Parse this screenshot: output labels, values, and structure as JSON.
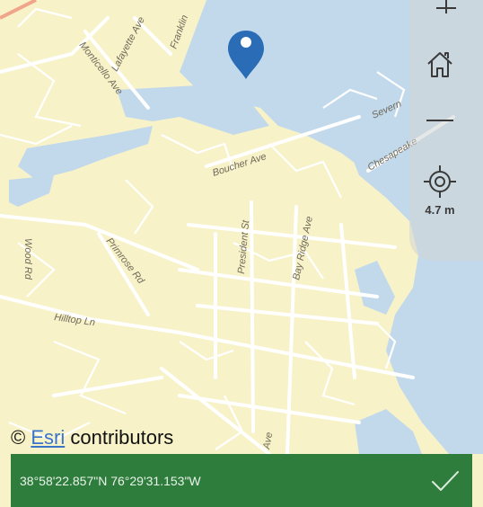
{
  "map": {
    "street_labels": {
      "monticello": "Monticello Ave",
      "lafayette": "Lafayette Ave",
      "franklin": "Franklin",
      "boucher": "Boucher Ave",
      "president": "President St",
      "bay_ridge": "Bay Ridge Ave",
      "primrose": "Primrose Rd",
      "hilltop": "Hilltop Ln",
      "chesapeake": "Chesapeake",
      "severn": "Severn",
      "wood": "Wood Rd",
      "ave_bottom": "Ave",
      "shuster": "Shuster Ave"
    },
    "colors": {
      "land": "#f8f2c8",
      "water": "#c2d9ec",
      "roads": "#ffffff",
      "pin": "#2a6cb5"
    }
  },
  "controls": {
    "zoom_in_icon": "plus-icon",
    "home_icon": "home-icon",
    "zoom_out_icon": "minus-icon",
    "locate_icon": "crosshair-icon",
    "accuracy": "4.7 m"
  },
  "attribution": {
    "prefix": "©",
    "link": "Esri",
    "suffix": "contributors"
  },
  "bottom_bar": {
    "coordinates": "38°58'22.857\"N 76°29'31.153\"W",
    "confirm_icon": "checkmark-icon",
    "color": "#2f7d3c"
  }
}
